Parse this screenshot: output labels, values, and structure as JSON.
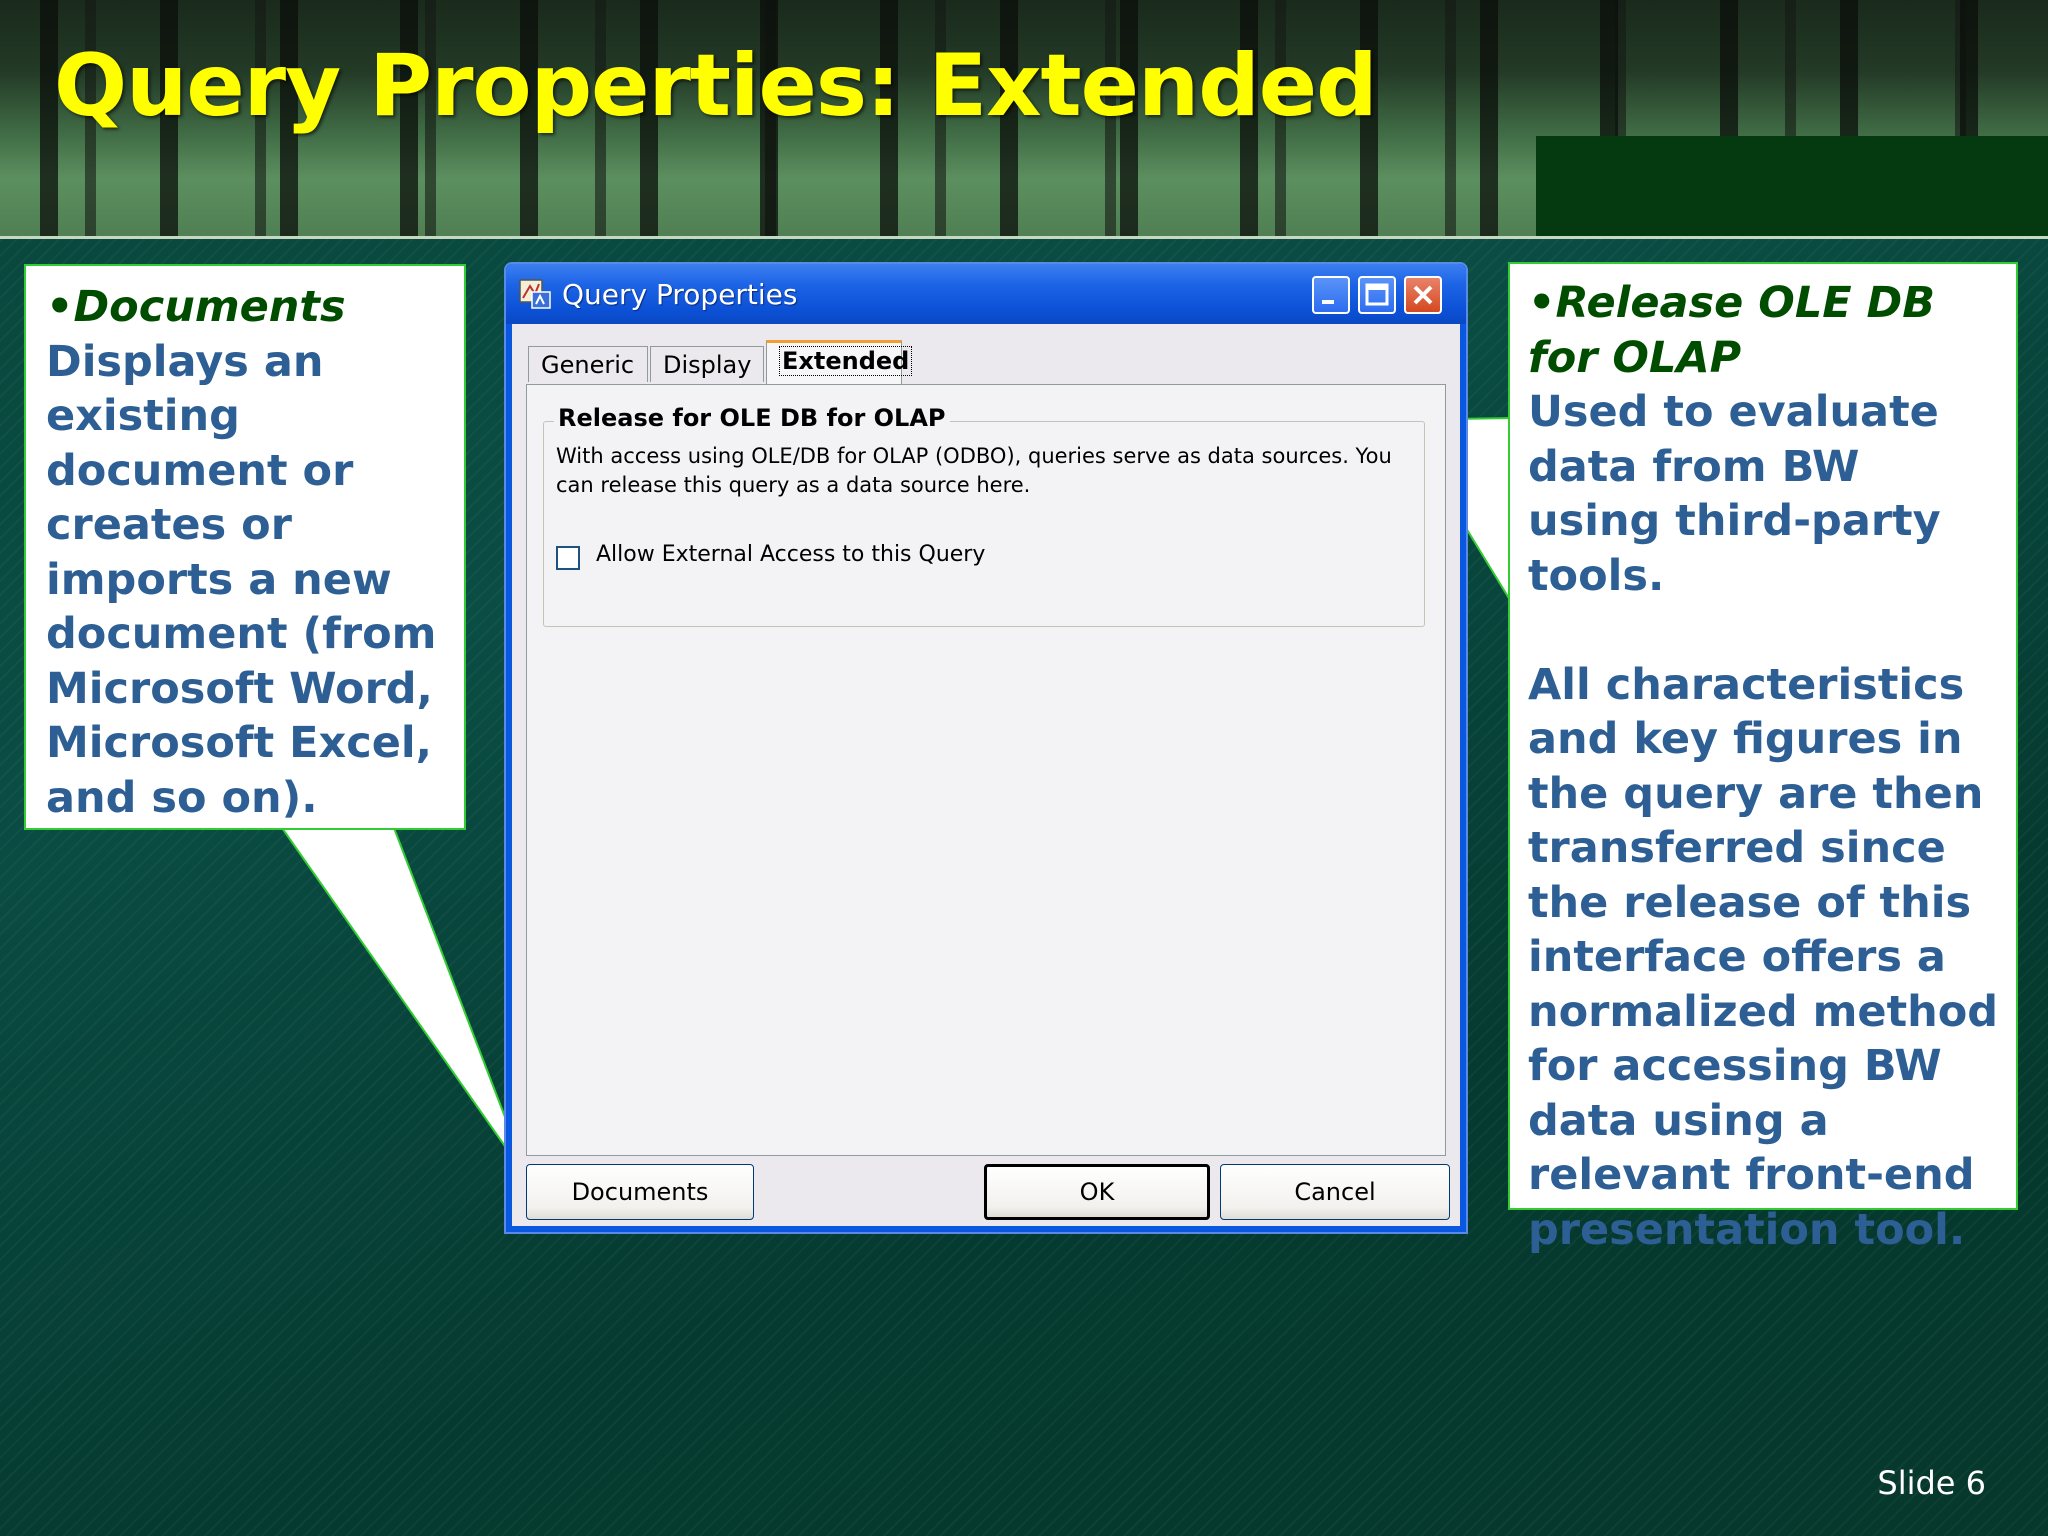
{
  "slide": {
    "title": "Query Properties: Extended",
    "number": "Slide 6"
  },
  "callout_left": {
    "heading": "•Documents",
    "body": "Displays an existing document or creates or imports a new document (from Microsoft Word, Microsoft Excel, and so on)."
  },
  "callout_right": {
    "heading": "•Release OLE DB for OLAP",
    "body1": "Used to evaluate data from BW using third-party tools.",
    "body2": "All characteristics and key figures in the query are then transferred since the release of this interface offers a normalized method for accessing BW data using a relevant front-end presentation tool."
  },
  "dialog": {
    "title": "Query Properties",
    "tabs": [
      {
        "label": "Generic"
      },
      {
        "label": "Display"
      },
      {
        "label": "Extended",
        "active": true
      }
    ],
    "group_title": "Release for OLE DB for OLAP",
    "group_desc": "With access using OLE/DB for OLAP (ODBO), queries serve as data sources. You can release this query as a data source here.",
    "checkbox_label": "Allow External Access to this Query",
    "checkbox_checked": false,
    "buttons": {
      "documents": "Documents",
      "ok": "OK",
      "cancel": "Cancel"
    }
  },
  "colors": {
    "title_yellow": "#ffff00",
    "callout_text": "#2e5f94",
    "callout_heading": "#004d00",
    "callout_border": "#33cc33",
    "xp_blue": "#0a57e0"
  }
}
